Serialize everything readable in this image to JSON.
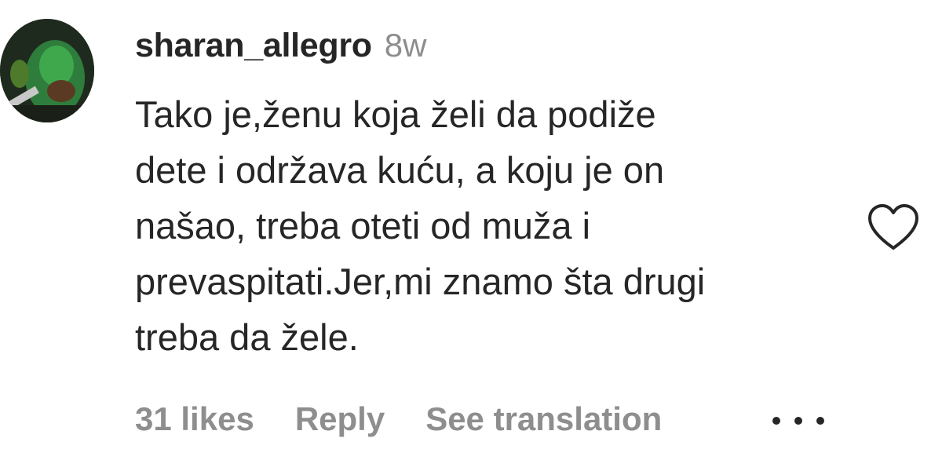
{
  "comment": {
    "username": "sharan_allegro",
    "timestamp": "8w",
    "text": "Tako je,ženu koja želi da podiže\ndete i održava kuću, a koju je on\nnašao, treba oteti od muža i\nprevaspitati.Jer,mi znamo šta drugi\ntreba da žele.",
    "likes": "31 likes",
    "reply_label": "Reply",
    "translate_label": "See translation"
  },
  "icons": {
    "like": "heart-outline-icon",
    "more": "more-options-icon",
    "avatar": "profile-avatar"
  },
  "colors": {
    "text": "#262626",
    "secondary": "#8e8e8e",
    "background": "#ffffff"
  }
}
